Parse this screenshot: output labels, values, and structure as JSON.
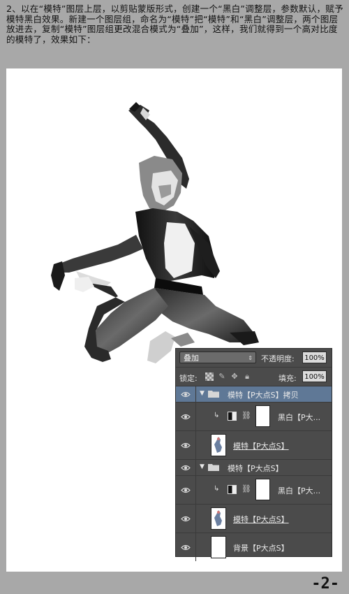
{
  "instructions": "2、以在“模特”图层上层，以剪贴蒙版形式，创建一个“黑白”调整层，参数默认，赋予模特黑白效果。新建一个图层组，命名为“模特”把“模特”和“黑白”调整层，两个图层放进去，复制“模特”图层组更改混合模式为“叠加”，这样，我们就得到一个高对比度的模特了，效果如下：",
  "footer": "-2-",
  "panel": {
    "blend_mode": "叠加",
    "opacity_label": "不透明度:",
    "opacity_value": "100%",
    "lock_label": "锁定:",
    "fill_label": "填充:",
    "fill_value": "100%",
    "layers": [
      {
        "name": "模特【P大点S】拷贝",
        "kind": "group",
        "selected": true
      },
      {
        "name": "黑白【P大...",
        "kind": "adjustment"
      },
      {
        "name": "模特【P大点S】",
        "kind": "image"
      },
      {
        "name": "模特【P大点S】",
        "kind": "group"
      },
      {
        "name": "黑白【P大...",
        "kind": "adjustment"
      },
      {
        "name": "模特【P大点S】",
        "kind": "image"
      },
      {
        "name": "背景【P大点S】",
        "kind": "background"
      }
    ]
  },
  "icons": {
    "eye": "eye-icon",
    "folder": "folder-icon",
    "chain": "chain-link-icon",
    "clip": "clipping-arrow-icon",
    "lock_pixels": "checkerboard-lock-icon",
    "lock_brush": "brush-lock-icon",
    "lock_move": "move-lock-icon",
    "lock_all": "padlock-icon"
  },
  "colors": {
    "background": "#a8a8a8",
    "panel": "#4b4b4b",
    "selected_layer": "#5f7896"
  }
}
